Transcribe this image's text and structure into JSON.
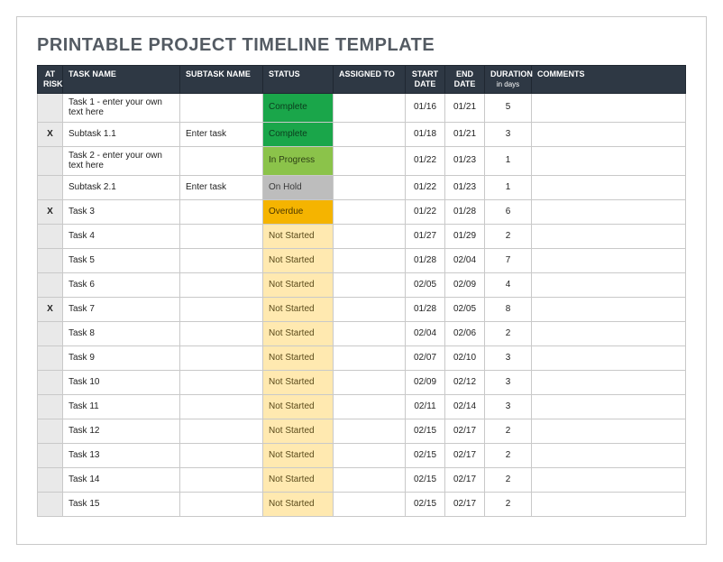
{
  "title": "PRINTABLE PROJECT TIMELINE TEMPLATE",
  "headers": {
    "risk": "AT RISK",
    "task": "TASK NAME",
    "subtask": "SUBTASK NAME",
    "status": "STATUS",
    "assigned": "ASSIGNED TO",
    "start": "START DATE",
    "end": "END DATE",
    "duration": "DURATION",
    "duration_sub": "in days",
    "comments": "COMMENTS"
  },
  "status_styles": {
    "Complete": "s-complete",
    "In Progress": "s-inprogress",
    "On Hold": "s-onhold",
    "Overdue": "s-overdue",
    "Not Started": "s-notstarted"
  },
  "rows": [
    {
      "risk": "",
      "task": "Task 1 - enter your own text here",
      "subtask": "",
      "status": "Complete",
      "assigned": "",
      "start": "01/16",
      "end": "01/21",
      "duration": "5",
      "comments": ""
    },
    {
      "risk": "X",
      "task": "Subtask 1.1",
      "subtask": "Enter task",
      "status": "Complete",
      "assigned": "",
      "start": "01/18",
      "end": "01/21",
      "duration": "3",
      "comments": ""
    },
    {
      "risk": "",
      "task": "Task 2 - enter your own text here",
      "subtask": "",
      "status": "In Progress",
      "assigned": "",
      "start": "01/22",
      "end": "01/23",
      "duration": "1",
      "comments": ""
    },
    {
      "risk": "",
      "task": "Subtask 2.1",
      "subtask": "Enter task",
      "status": "On Hold",
      "assigned": "",
      "start": "01/22",
      "end": "01/23",
      "duration": "1",
      "comments": ""
    },
    {
      "risk": "X",
      "task": "Task 3",
      "subtask": "",
      "status": "Overdue",
      "assigned": "",
      "start": "01/22",
      "end": "01/28",
      "duration": "6",
      "comments": ""
    },
    {
      "risk": "",
      "task": "Task 4",
      "subtask": "",
      "status": "Not Started",
      "assigned": "",
      "start": "01/27",
      "end": "01/29",
      "duration": "2",
      "comments": ""
    },
    {
      "risk": "",
      "task": "Task 5",
      "subtask": "",
      "status": "Not Started",
      "assigned": "",
      "start": "01/28",
      "end": "02/04",
      "duration": "7",
      "comments": ""
    },
    {
      "risk": "",
      "task": "Task 6",
      "subtask": "",
      "status": "Not Started",
      "assigned": "",
      "start": "02/05",
      "end": "02/09",
      "duration": "4",
      "comments": ""
    },
    {
      "risk": "X",
      "task": "Task 7",
      "subtask": "",
      "status": "Not Started",
      "assigned": "",
      "start": "01/28",
      "end": "02/05",
      "duration": "8",
      "comments": ""
    },
    {
      "risk": "",
      "task": "Task 8",
      "subtask": "",
      "status": "Not Started",
      "assigned": "",
      "start": "02/04",
      "end": "02/06",
      "duration": "2",
      "comments": ""
    },
    {
      "risk": "",
      "task": "Task 9",
      "subtask": "",
      "status": "Not Started",
      "assigned": "",
      "start": "02/07",
      "end": "02/10",
      "duration": "3",
      "comments": ""
    },
    {
      "risk": "",
      "task": "Task 10",
      "subtask": "",
      "status": "Not Started",
      "assigned": "",
      "start": "02/09",
      "end": "02/12",
      "duration": "3",
      "comments": ""
    },
    {
      "risk": "",
      "task": "Task 11",
      "subtask": "",
      "status": "Not Started",
      "assigned": "",
      "start": "02/11",
      "end": "02/14",
      "duration": "3",
      "comments": ""
    },
    {
      "risk": "",
      "task": "Task 12",
      "subtask": "",
      "status": "Not Started",
      "assigned": "",
      "start": "02/15",
      "end": "02/17",
      "duration": "2",
      "comments": ""
    },
    {
      "risk": "",
      "task": "Task 13",
      "subtask": "",
      "status": "Not Started",
      "assigned": "",
      "start": "02/15",
      "end": "02/17",
      "duration": "2",
      "comments": ""
    },
    {
      "risk": "",
      "task": "Task 14",
      "subtask": "",
      "status": "Not Started",
      "assigned": "",
      "start": "02/15",
      "end": "02/17",
      "duration": "2",
      "comments": ""
    },
    {
      "risk": "",
      "task": "Task 15",
      "subtask": "",
      "status": "Not Started",
      "assigned": "",
      "start": "02/15",
      "end": "02/17",
      "duration": "2",
      "comments": ""
    }
  ]
}
